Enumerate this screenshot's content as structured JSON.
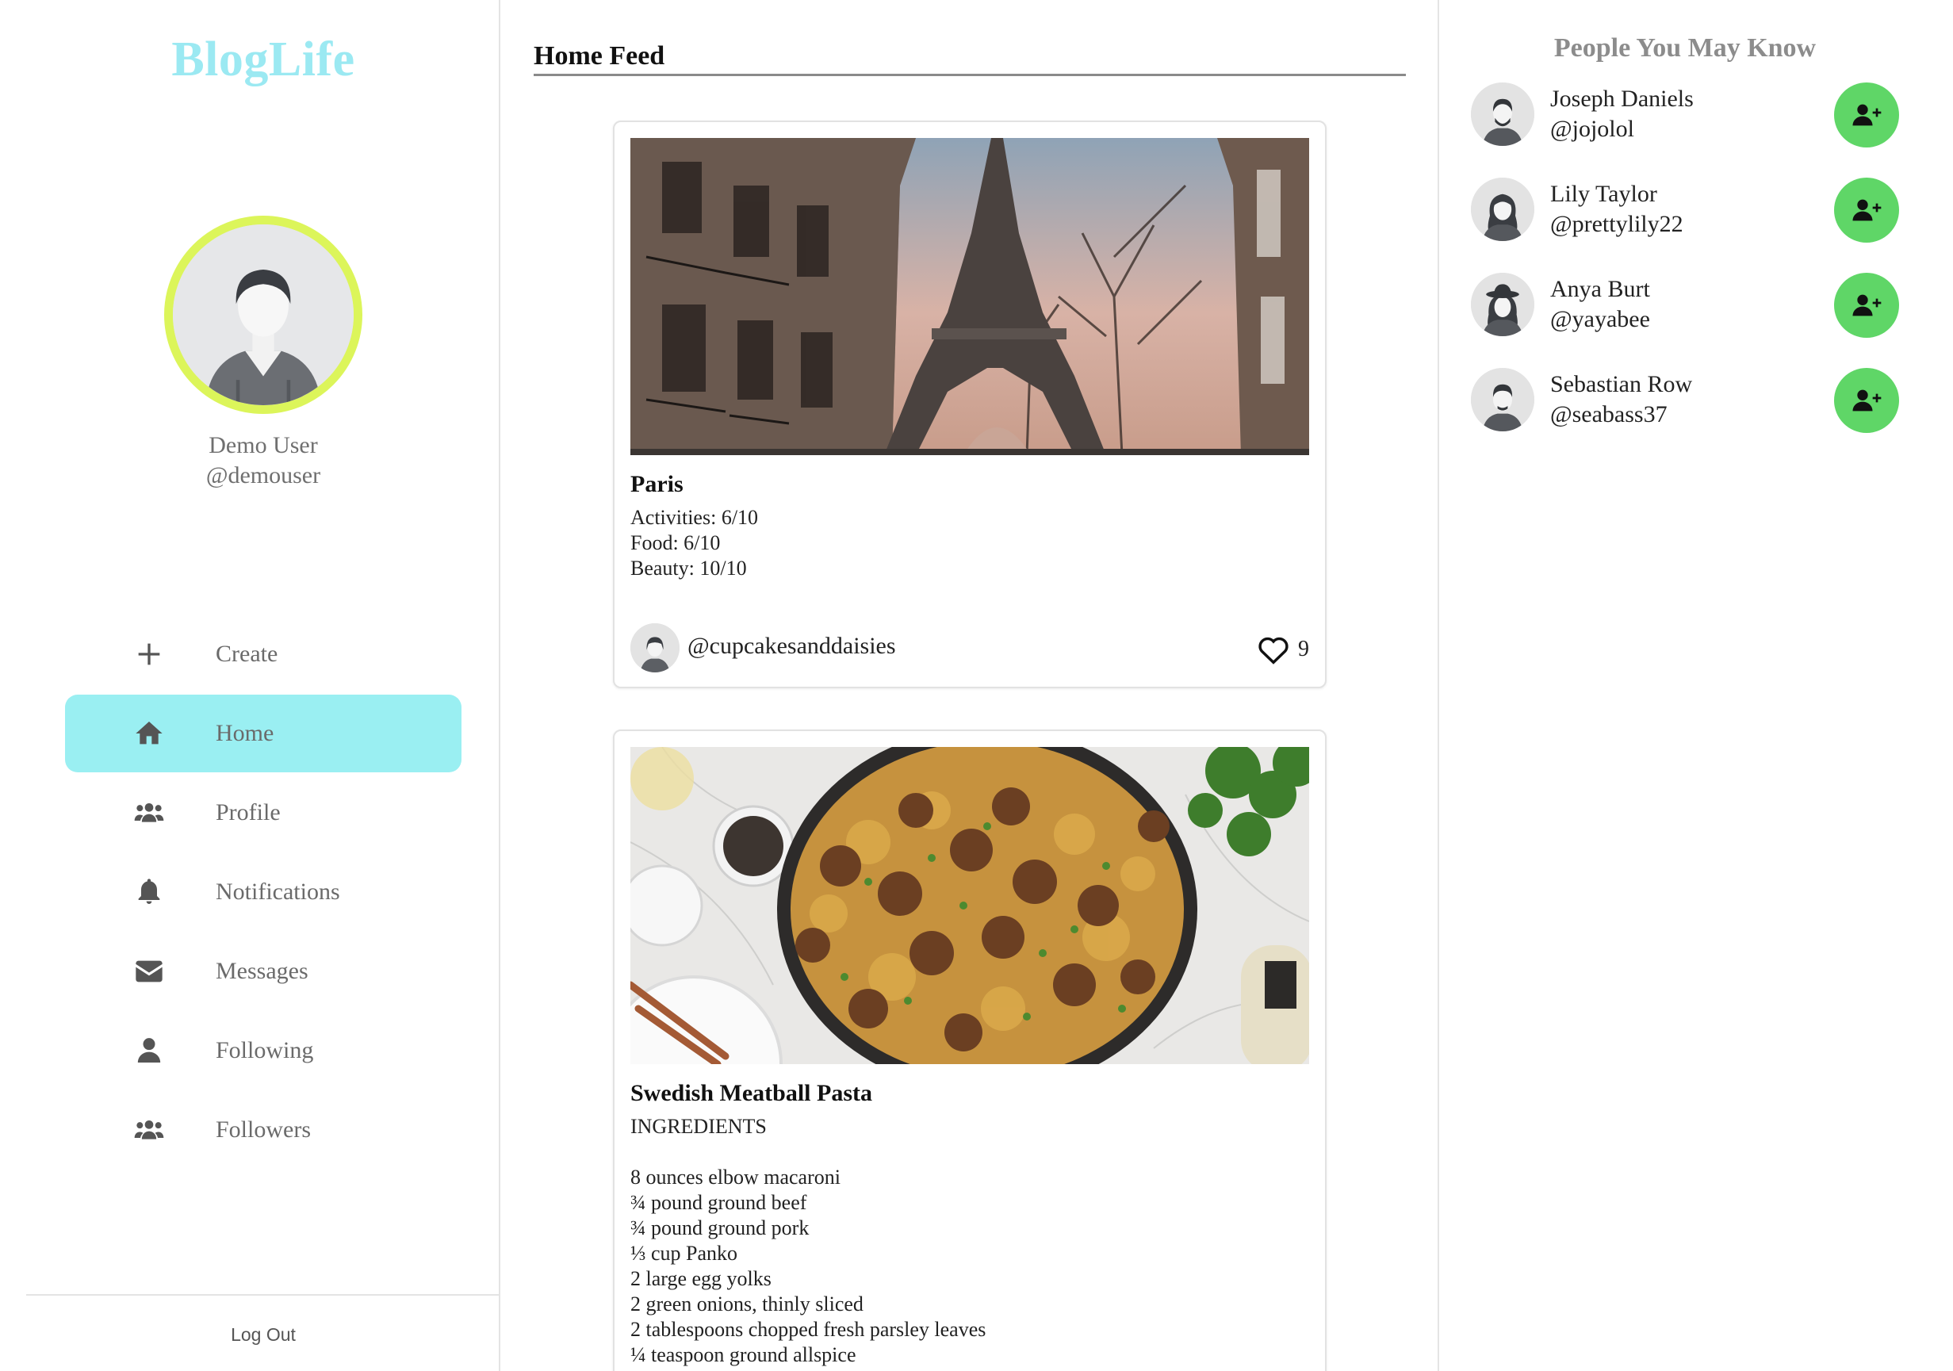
{
  "app": {
    "brand": "BlogLife"
  },
  "user": {
    "name": "Demo User",
    "handle": "@demouser"
  },
  "nav": [
    {
      "label": "Create",
      "icon": "plus-icon",
      "active": false
    },
    {
      "label": "Home",
      "icon": "home-icon",
      "active": true
    },
    {
      "label": "Profile",
      "icon": "users-icon",
      "active": false
    },
    {
      "label": "Notifications",
      "icon": "bell-icon",
      "active": false
    },
    {
      "label": "Messages",
      "icon": "envelope-icon",
      "active": false
    },
    {
      "label": "Following",
      "icon": "user-icon",
      "active": false
    },
    {
      "label": "Followers",
      "icon": "users-icon",
      "active": false
    }
  ],
  "logout_label": "Log Out",
  "feed": {
    "title": "Home Feed",
    "posts": [
      {
        "title": "Paris",
        "body": "Activities: 6/10\nFood: 6/10\nBeauty: 10/10",
        "author": "@cupcakesanddaisies",
        "likes": "9",
        "image": "eiffel-tower-photo"
      },
      {
        "title": "Swedish Meatball Pasta",
        "body": "INGREDIENTS\n\n8 ounces elbow macaroni\n¾ pound ground beef\n¾ pound ground pork\n⅓ cup Panko\n2 large egg yolks\n2 green onions, thinly sliced\n2 tablespoons chopped fresh parsley leaves\n¼ teaspoon ground allspice",
        "image": "meatball-pasta-photo"
      }
    ]
  },
  "suggestions": {
    "title": "People You May Know",
    "people": [
      {
        "name": "Joseph Daniels",
        "handle": "@jojolol"
      },
      {
        "name": "Lily Taylor",
        "handle": "@prettylily22"
      },
      {
        "name": "Anya Burt",
        "handle": "@yayabee"
      },
      {
        "name": "Sebastian Row",
        "handle": "@seabass37"
      }
    ]
  },
  "colors": {
    "brand": "#9be9f2",
    "active_nav": "#9aeff2",
    "avatar_ring": "#dcf55a",
    "add_button": "#5fd667"
  }
}
